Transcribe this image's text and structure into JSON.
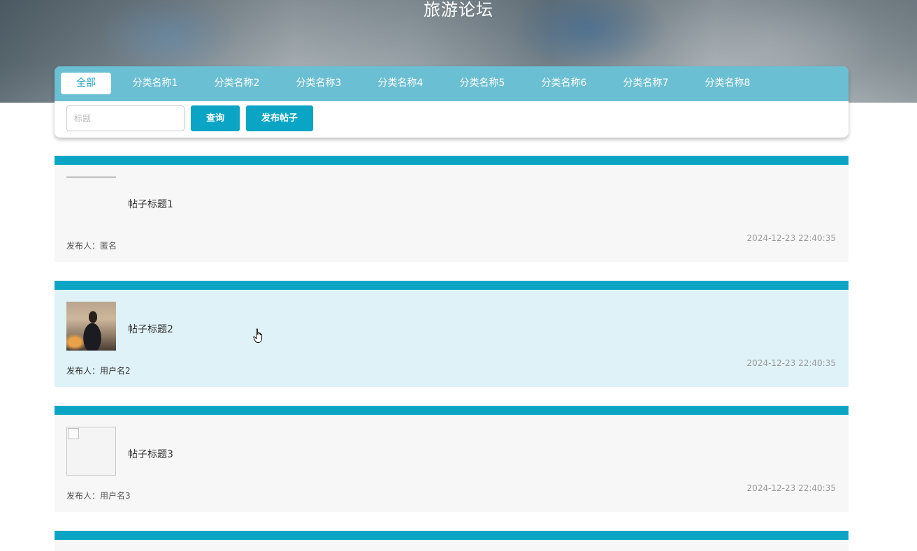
{
  "header": {
    "title": "旅游论坛"
  },
  "tabs": [
    {
      "label": "全部",
      "active": true
    },
    {
      "label": "分类名称1",
      "active": false
    },
    {
      "label": "分类名称2",
      "active": false
    },
    {
      "label": "分类名称3",
      "active": false
    },
    {
      "label": "分类名称4",
      "active": false
    },
    {
      "label": "分类名称5",
      "active": false
    },
    {
      "label": "分类名称6",
      "active": false
    },
    {
      "label": "分类名称7",
      "active": false
    },
    {
      "label": "分类名称8",
      "active": false
    }
  ],
  "search": {
    "placeholder": "标题",
    "value": ""
  },
  "buttons": {
    "query": "查询",
    "publish": "发布帖子"
  },
  "posts": [
    {
      "title": "帖子标题1",
      "author": "发布人：匿名",
      "time": "2024-12-23 22:40:35",
      "image": "blank"
    },
    {
      "title": "帖子标题2",
      "author": "发布人：用户名2",
      "time": "2024-12-23 22:40:35",
      "image": "photo"
    },
    {
      "title": "帖子标题3",
      "author": "发布人：用户名3",
      "time": "2024-12-23 22:40:35",
      "image": "broken"
    }
  ],
  "colors": {
    "accent": "#0aa5c5",
    "tabbar": "#6bbfd2",
    "hover_row": "#dff2f7"
  }
}
